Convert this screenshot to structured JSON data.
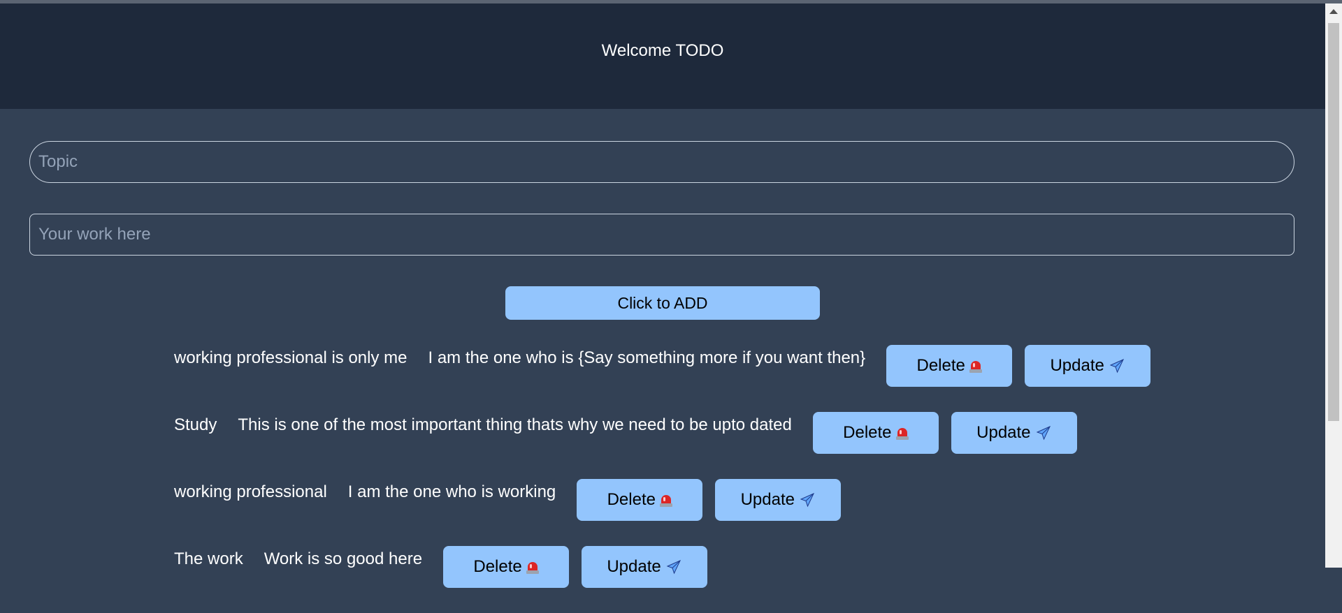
{
  "header": {
    "title": "Welcome TODO"
  },
  "form": {
    "topic_placeholder": "Topic",
    "work_placeholder": "Your work here",
    "add_label": "Click to ADD"
  },
  "todos": [
    {
      "topic": "working professional is only me",
      "description": "I am the one who is {Say something more if you want then}",
      "delete_label": "Delete",
      "update_label": "Update"
    },
    {
      "topic": "Study",
      "description": "This is one of the most important thing thats why we need to be upto dated",
      "delete_label": "Delete",
      "update_label": "Update"
    },
    {
      "topic": "working professional",
      "description": "I am the one who is working",
      "delete_label": "Delete",
      "update_label": "Update"
    },
    {
      "topic": "The work",
      "description": "Work is so good here",
      "delete_label": "Delete",
      "update_label": "Update"
    }
  ],
  "icons": {
    "delete": "siren-icon",
    "update": "airplane-icon"
  },
  "colors": {
    "header_bg": "#1e293b",
    "page_bg": "#334155",
    "button_bg": "#93c5fd"
  }
}
